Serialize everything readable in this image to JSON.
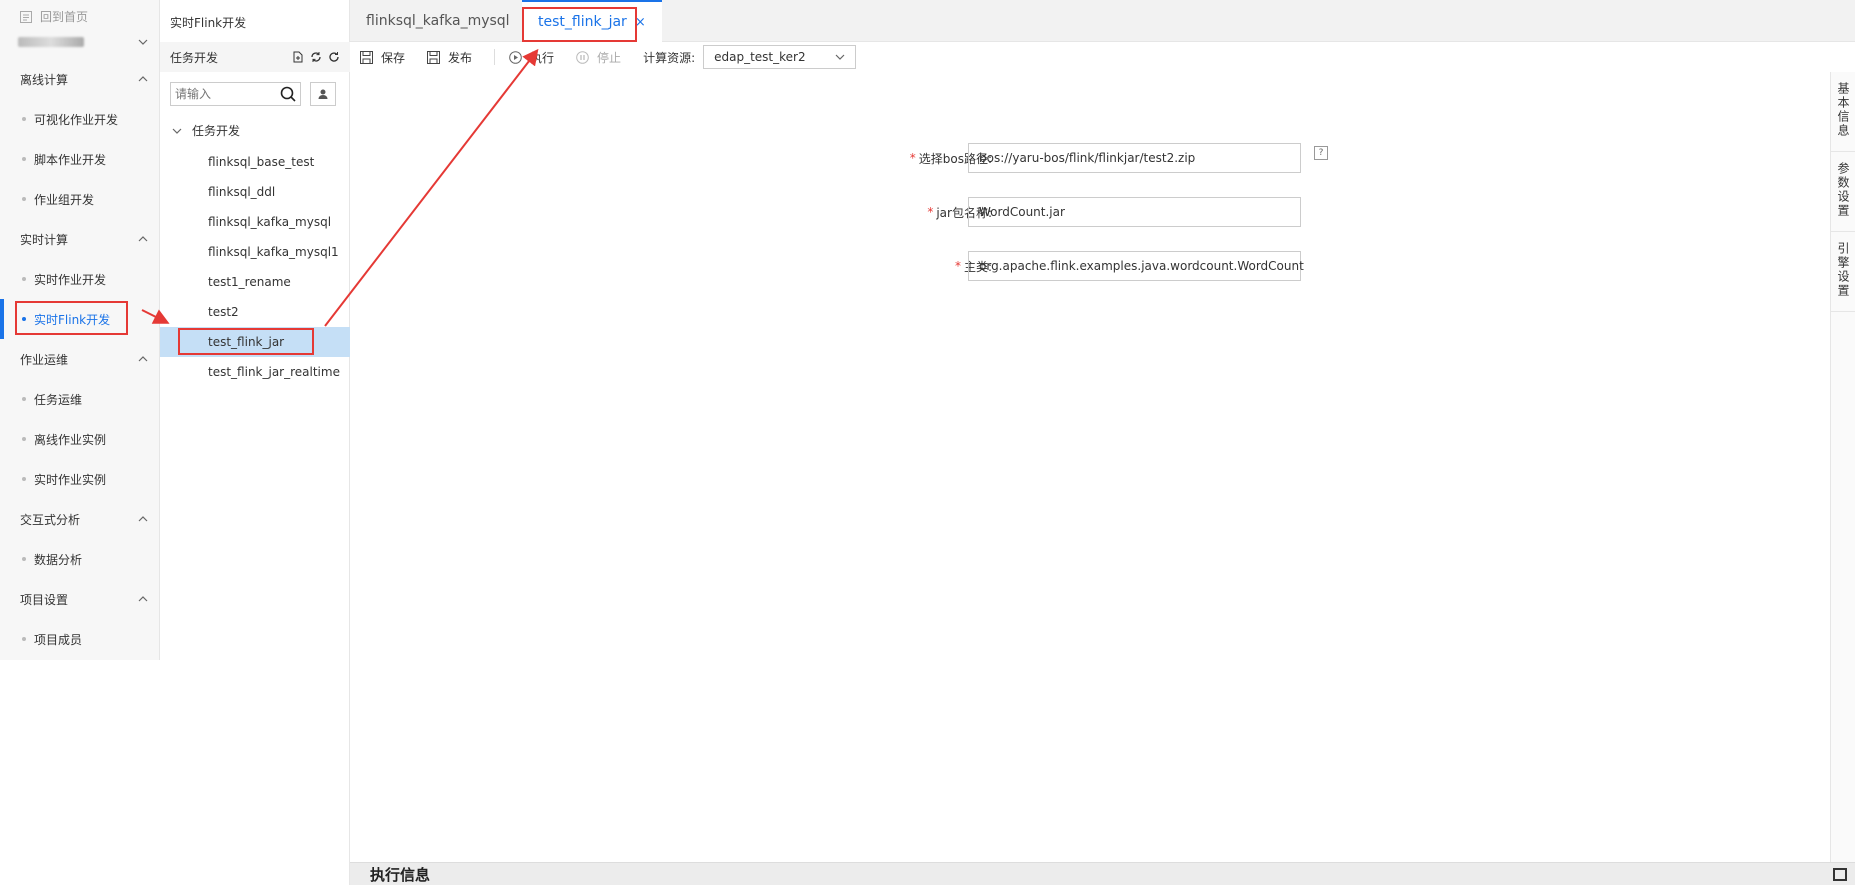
{
  "nav": {
    "back_label": "回到首页",
    "sections": [
      {
        "title": "离线计算",
        "items": [
          "可视化作业开发",
          "脚本作业开发",
          "作业组开发"
        ]
      },
      {
        "title": "实时计算",
        "items": [
          "实时作业开发",
          "实时Flink开发"
        ]
      },
      {
        "title": "作业运维",
        "items": [
          "任务运维",
          "离线作业实例",
          "实时作业实例"
        ]
      },
      {
        "title": "交互式分析",
        "items": [
          "数据分析"
        ]
      },
      {
        "title": "项目设置",
        "items": [
          "项目成员"
        ]
      }
    ],
    "active_item": "实时Flink开发"
  },
  "tree": {
    "header": "实时Flink开发",
    "subheader": "任务开发",
    "search_placeholder": "请输入",
    "folder": "任务开发",
    "files": [
      "flinksql_base_test",
      "flinksql_ddl",
      "flinksql_kafka_mysql",
      "flinksql_kafka_mysql1",
      "test1_rename",
      "test2",
      "test_flink_jar",
      "test_flink_jar_realtime"
    ],
    "selected_file": "test_flink_jar"
  },
  "tabs": [
    {
      "label": "flinksql_kafka_mysql",
      "active": false
    },
    {
      "label": "test_flink_jar",
      "active": true,
      "close": "×"
    }
  ],
  "toolbar": {
    "save": "保存",
    "publish": "发布",
    "run": "执行",
    "stop": "停止",
    "resource_label": "计算资源:",
    "resource_value": "edap_test_ker2"
  },
  "form": {
    "bos_label": "选择bos路径:",
    "bos_value": "bos://yaru-bos/flink/flinkjar/test2.zip",
    "help_glyph": "?",
    "jar_label": "jar包名称:",
    "jar_value": "WordCount.jar",
    "main_label": "主类:",
    "main_value": "org.apache.flink.examples.java.wordcount.WordCount",
    "required_mark": "*"
  },
  "side_tabs": [
    "基本信息",
    "参数设置",
    "引擎设置"
  ],
  "exec_panel": {
    "title": "执行信息"
  },
  "colors": {
    "accent": "#1a73e8",
    "annotation": "#e53935",
    "selected_row": "#c5dff6"
  }
}
